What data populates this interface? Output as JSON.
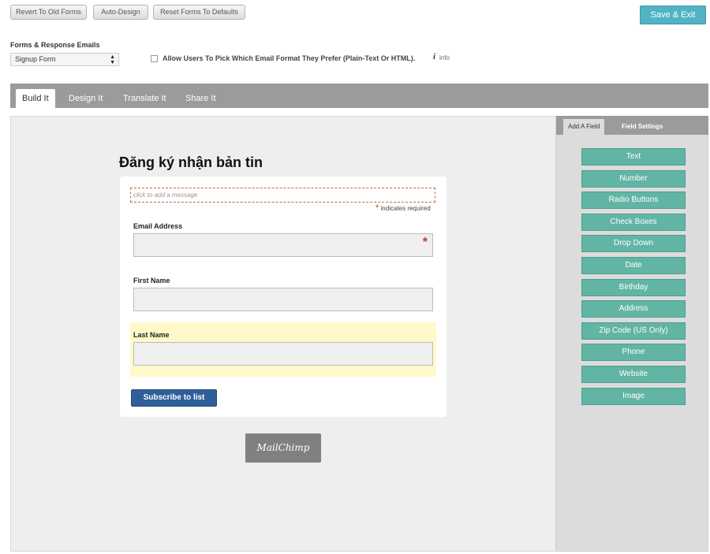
{
  "toolbar": {
    "revert_label": "Revert To Old Forms",
    "auto_design_label": "Auto-Design",
    "reset_label": "Reset Forms To Defaults",
    "save_exit_label": "Save & Exit"
  },
  "forms": {
    "section_label": "Forms & Response Emails",
    "selected_form": "Signup Form",
    "email_format_option": "Allow Users To Pick Which Email Format They Prefer (Plain-Text Or HTML).",
    "email_format_checked": false,
    "info_label": "info"
  },
  "tabs": [
    {
      "label": "Build It",
      "active": true
    },
    {
      "label": "Design It",
      "active": false
    },
    {
      "label": "Translate It",
      "active": false
    },
    {
      "label": "Share It",
      "active": false
    }
  ],
  "form_preview": {
    "title": "Đăng ký nhận bản tin",
    "message_placeholder": "click to add a message",
    "required_star": "*",
    "required_note": "indicates required",
    "fields": [
      {
        "label": "Email Address",
        "required": true
      },
      {
        "label": "First Name",
        "required": false
      },
      {
        "label": "Last Name",
        "required": false
      }
    ],
    "submit_label": "Subscribe to list",
    "logo_text": "MailChimp"
  },
  "right_panel": {
    "tabs": [
      {
        "label": "Add A Field",
        "active": true
      },
      {
        "label": "Field Settings",
        "active": false
      }
    ],
    "field_types": [
      "Text",
      "Number",
      "Radio Buttons",
      "Check Boxes",
      "Drop Down",
      "Date",
      "Birthday",
      "Address",
      "Zip Code (US Only)",
      "Phone",
      "Website",
      "Image"
    ]
  },
  "colors": {
    "save_button": "#52b3c4",
    "field_button": "#62b5a5",
    "submit_button": "#2f5f9a",
    "highlight": "#fff9c9"
  }
}
